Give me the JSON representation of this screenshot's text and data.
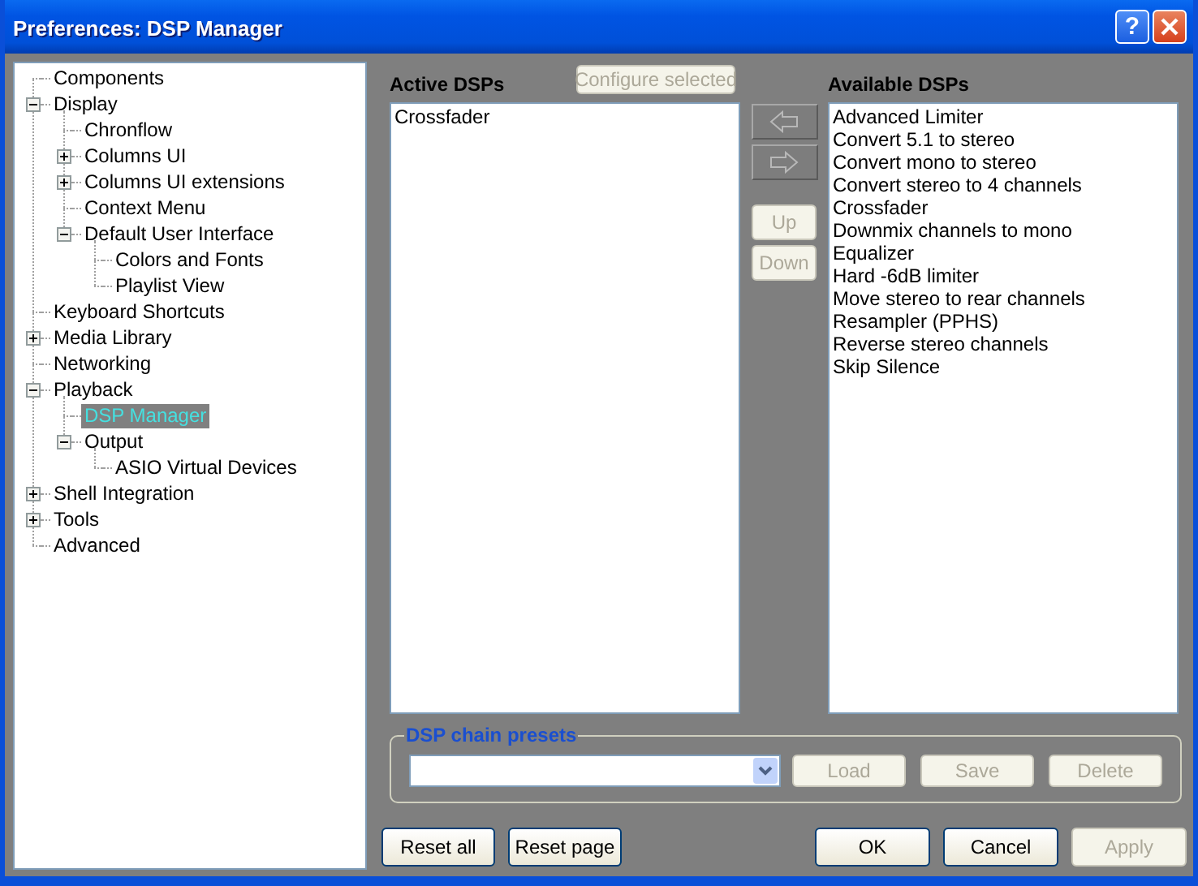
{
  "window": {
    "title": "Preferences: DSP Manager",
    "help_button": "?"
  },
  "tree": [
    {
      "label": "Components",
      "selected": false
    },
    {
      "label": "Display",
      "selected": false,
      "expanded": true,
      "children": [
        {
          "label": "Chronflow",
          "selected": false
        },
        {
          "label": "Columns UI",
          "selected": false,
          "expanded": false
        },
        {
          "label": "Columns UI extensions",
          "selected": false,
          "expanded": false
        },
        {
          "label": "Context Menu",
          "selected": false
        },
        {
          "label": "Default User Interface",
          "selected": false,
          "expanded": true,
          "children": [
            {
              "label": "Colors and Fonts",
              "selected": false
            },
            {
              "label": "Playlist View",
              "selected": false
            }
          ]
        }
      ]
    },
    {
      "label": "Keyboard Shortcuts",
      "selected": false
    },
    {
      "label": "Media Library",
      "selected": false,
      "expanded": false
    },
    {
      "label": "Networking",
      "selected": false
    },
    {
      "label": "Playback",
      "selected": false,
      "expanded": true,
      "children": [
        {
          "label": "DSP Manager",
          "selected": true
        },
        {
          "label": "Output",
          "selected": false,
          "expanded": true,
          "children": [
            {
              "label": "ASIO Virtual Devices",
              "selected": false
            }
          ]
        }
      ]
    },
    {
      "label": "Shell Integration",
      "selected": false,
      "expanded": false
    },
    {
      "label": "Tools",
      "selected": false,
      "expanded": false
    },
    {
      "label": "Advanced",
      "selected": false
    }
  ],
  "active_dsps": {
    "label": "Active DSPs",
    "configure_button": {
      "label": "Configure selected",
      "disabled": true
    },
    "items": [
      "Crossfader"
    ]
  },
  "move_buttons": [
    {
      "kind": "add",
      "disabled": true
    },
    {
      "kind": "remove",
      "disabled": true
    }
  ],
  "order_buttons": [
    {
      "label": "Up",
      "disabled": true
    },
    {
      "label": "Down",
      "disabled": true
    }
  ],
  "available_dsps": {
    "label": "Available DSPs",
    "items": [
      "Advanced Limiter",
      "Convert 5.1 to stereo",
      "Convert mono to stereo",
      "Convert stereo to 4 channels",
      "Crossfader",
      "Downmix channels to mono",
      "Equalizer",
      "Hard -6dB limiter",
      "Move stereo to rear channels",
      "Resampler (PPHS)",
      "Reverse stereo channels",
      "Skip Silence"
    ]
  },
  "presets": {
    "legend": "DSP chain presets",
    "buttons": [
      {
        "label": "Load",
        "disabled": true
      },
      {
        "label": "Save",
        "disabled": true
      },
      {
        "label": "Delete",
        "disabled": true
      }
    ]
  },
  "footer": {
    "left_buttons": [
      {
        "label": "Reset all",
        "disabled": false
      },
      {
        "label": "Reset page",
        "disabled": false
      }
    ],
    "right_buttons": [
      {
        "label": "OK",
        "disabled": false
      },
      {
        "label": "Cancel",
        "disabled": false
      },
      {
        "label": "Apply",
        "disabled": true
      }
    ]
  }
}
